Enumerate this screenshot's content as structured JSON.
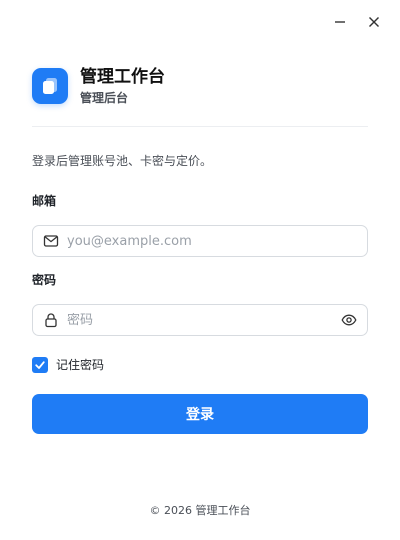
{
  "window": {
    "minimize_icon": "minimize-icon",
    "close_icon": "close-icon"
  },
  "brand": {
    "title": "管理工作台",
    "subtitle": "管理后台",
    "logo_icon": "app-logo-icon",
    "accent": "#1f7cf5"
  },
  "intro": "登录后管理账号池、卡密与定价。",
  "form": {
    "email_label": "邮箱",
    "email_placeholder": "you@example.com",
    "email_value": "",
    "email_icon": "mail-icon",
    "password_label": "密码",
    "password_placeholder": "密码",
    "password_value": "",
    "password_icon": "lock-icon",
    "visibility_icon": "eye-icon",
    "remember_label": "记住密码",
    "remember_checked": true,
    "submit_label": "登录"
  },
  "footer": "© 2026 管理工作台"
}
